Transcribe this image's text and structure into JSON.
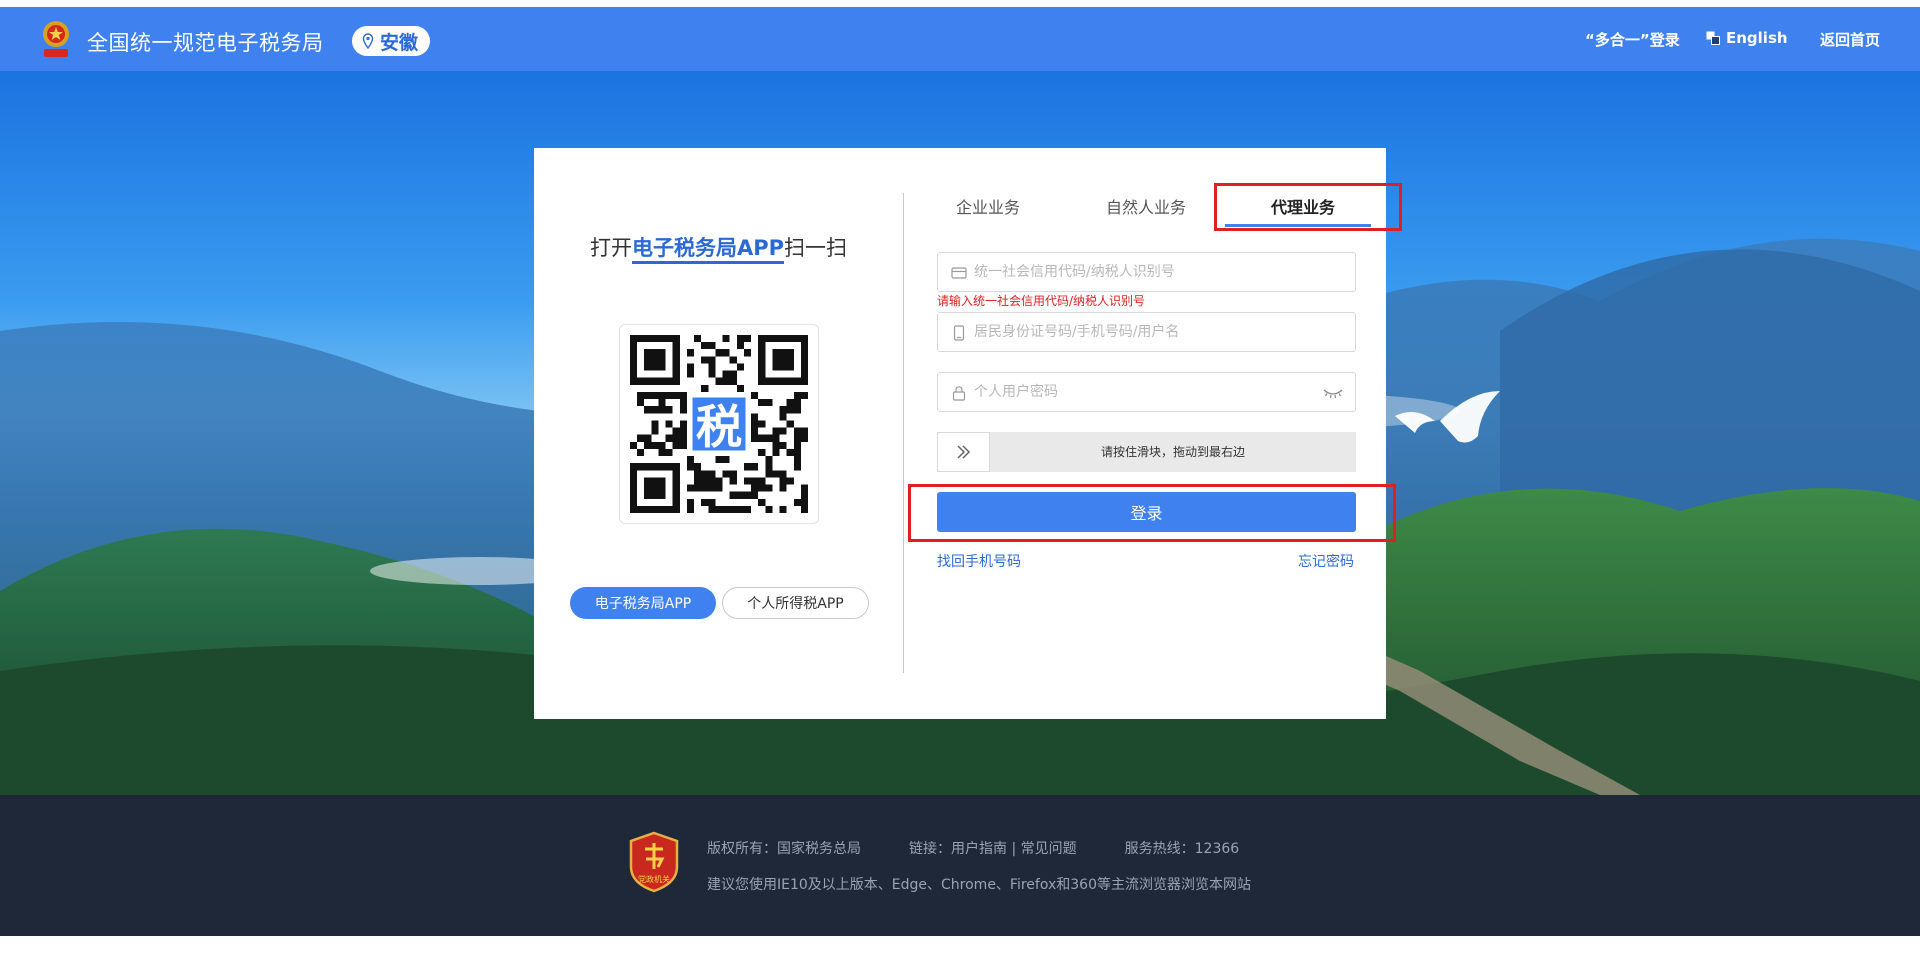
{
  "header": {
    "site_title": "全国统一规范电子税务局",
    "region": "安徽",
    "nav_login": "“多合一”登录",
    "nav_english": "English",
    "nav_home": "返回首页"
  },
  "scan": {
    "title_prefix": "打开",
    "title_highlight": "电子税务局APP",
    "title_suffix": "扫一扫",
    "qr_center_char": "税",
    "app_buttons": [
      "电子税务局APP",
      "个人所得税APP"
    ]
  },
  "tabs": [
    {
      "label": "企业业务",
      "active": false
    },
    {
      "label": "自然人业务",
      "active": false
    },
    {
      "label": "代理业务",
      "active": true
    }
  ],
  "form": {
    "credit_code_placeholder": "统一社会信用代码/纳税人识别号",
    "credit_code_value": "",
    "credit_code_error": "请输入统一社会信用代码/纳税人识别号",
    "id_placeholder": "居民身份证号码/手机号码/用户名",
    "id_value": "",
    "password_placeholder": "个人用户密码",
    "password_value": "",
    "slider_text": "请按住滑块，拖动到最右边",
    "slider_progress": 0,
    "login_label": "登录",
    "link_find_phone": "找回手机号码",
    "link_forgot_password": "忘记密码"
  },
  "footer": {
    "copyright": "版权所有：国家税务总局",
    "links": "链接：用户指南 | 常见问题",
    "hotline": "服务热线：12366",
    "browser_tip": "建议您使用IE10及以上版本、Edge、Chrome、Firefox和360等主流浏览器浏览本网站",
    "badge_text": "党政机关"
  },
  "colors": {
    "header_blue": "#3f82ef",
    "link_blue": "#2b6ad6",
    "error_red": "#e02020",
    "footer_bg": "#1e2838",
    "annotation_red": "#e02020"
  },
  "icons": {
    "emblem": "national-emblem-icon",
    "region": "location-pin-icon",
    "language": "language-icon",
    "credit_field": "id-card-icon",
    "id_field": "mobile-icon",
    "password_field": "lock-icon",
    "password_toggle": "eye-closed-icon",
    "slider": "double-chevron-right-icon"
  }
}
